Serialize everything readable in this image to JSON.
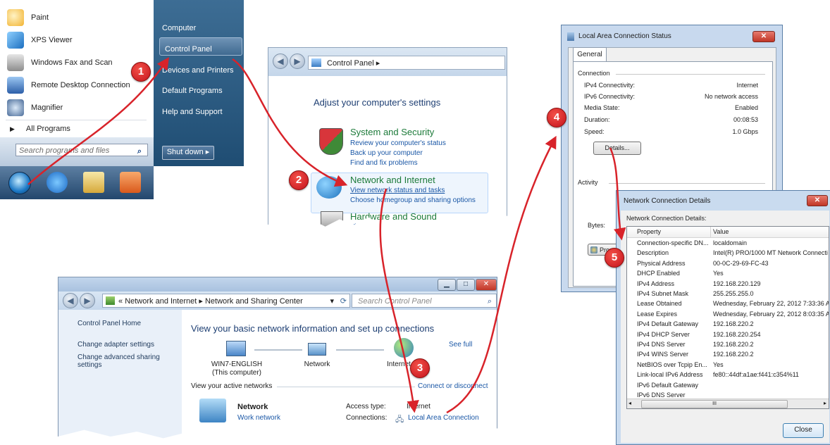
{
  "start_menu": {
    "left_items": [
      {
        "label": "Paint",
        "icon": "paint-icon",
        "color": "#f2b331"
      },
      {
        "label": "XPS Viewer",
        "icon": "xps-viewer-icon",
        "color": "#3a8ed8"
      },
      {
        "label": "Windows Fax and Scan",
        "icon": "fax-scan-icon",
        "color": "#8c8c8c"
      },
      {
        "label": "Remote Desktop Connection",
        "icon": "remote-desktop-icon",
        "color": "#3d78c5"
      },
      {
        "label": "Magnifier",
        "icon": "magnifier-icon",
        "color": "#4a6c99"
      }
    ],
    "all_programs": "All Programs",
    "search_placeholder": "Search programs and files",
    "right_items": [
      "Computer",
      "Control Panel",
      "Devices and Printers",
      "Default Programs",
      "Help and Support"
    ],
    "shutdown": "Shut down"
  },
  "control_panel": {
    "breadcrumb": "Control Panel",
    "heading": "Adjust your computer's settings",
    "categories": [
      {
        "title": "System and Security",
        "links": [
          "Review your computer's status",
          "Back up your computer",
          "Find and fix problems"
        ]
      },
      {
        "title": "Network and Internet",
        "links": [
          "View network status and tasks",
          "Choose homegroup and sharing options"
        ]
      },
      {
        "title": "Hardware and Sound",
        "links": [
          "View d"
        ]
      }
    ]
  },
  "network_center": {
    "breadcrumb_a": "Network and Internet",
    "breadcrumb_b": "Network and Sharing Center",
    "search_placeholder": "Search Control Panel",
    "sidebar": [
      "Control Panel Home",
      "Change adapter settings",
      "Change advanced sharing settings"
    ],
    "heading": "View your basic network information and set up connections",
    "see_full": "See full",
    "computer_name": "WIN7-ENGLISH",
    "computer_sub": "(This computer)",
    "network_label": "Network",
    "internet_label": "Internet",
    "active_networks": "View your active networks",
    "connect_link": "Connect or disconnect",
    "active_network_name": "Network",
    "active_network_type": "Work network",
    "access_type_label": "Access type:",
    "access_type_value": "Internet",
    "connections_label": "Connections:",
    "connections_value": "Local Area Connection"
  },
  "lac_status": {
    "title": "Local Area Connection Status",
    "tab": "General",
    "connection_section": "Connection",
    "rows": [
      {
        "label": "IPv4 Connectivity:",
        "value": "Internet"
      },
      {
        "label": "IPv6 Connectivity:",
        "value": "No network access"
      },
      {
        "label": "Media State:",
        "value": "Enabled"
      },
      {
        "label": "Duration:",
        "value": "00:08:53"
      },
      {
        "label": "Speed:",
        "value": "1.0 Gbps"
      }
    ],
    "details_button": "Details...",
    "activity_section": "Activity",
    "bytes_label": "Bytes:",
    "properties_button": "Prop"
  },
  "ncd": {
    "title": "Network Connection Details",
    "caption": "Network Connection Details:",
    "col_property": "Property",
    "col_value": "Value",
    "rows": [
      {
        "p": "Connection-specific DN...",
        "v": "localdomain"
      },
      {
        "p": "Description",
        "v": "Intel(R) PRO/1000 MT Network Connecti"
      },
      {
        "p": "Physical Address",
        "v": "00-0C-29-69-FC-43"
      },
      {
        "p": "DHCP Enabled",
        "v": "Yes"
      },
      {
        "p": "IPv4 Address",
        "v": "192.168.220.129"
      },
      {
        "p": "IPv4 Subnet Mask",
        "v": "255.255.255.0"
      },
      {
        "p": "Lease Obtained",
        "v": "Wednesday, February 22, 2012 7:33:36 A"
      },
      {
        "p": "Lease Expires",
        "v": "Wednesday, February 22, 2012 8:03:35 A"
      },
      {
        "p": "IPv4 Default Gateway",
        "v": "192.168.220.2"
      },
      {
        "p": "IPv4 DHCP Server",
        "v": "192.168.220.254"
      },
      {
        "p": "IPv4 DNS Server",
        "v": "192.168.220.2"
      },
      {
        "p": "IPv4 WINS Server",
        "v": "192.168.220.2"
      },
      {
        "p": "NetBIOS over Tcpip En...",
        "v": "Yes"
      },
      {
        "p": "Link-local IPv6 Address",
        "v": "fe80::44df:a1ae:f441:c354%11"
      },
      {
        "p": "IPv6 Default Gateway",
        "v": ""
      },
      {
        "p": "IPv6 DNS Server",
        "v": ""
      }
    ],
    "scroll_mark": "III",
    "close_button": "Close"
  },
  "steps": [
    "1",
    "2",
    "3",
    "4",
    "5"
  ],
  "colors": {
    "arrow": "#d8232a",
    "link": "#1a57a6",
    "category": "#1c7a39"
  }
}
